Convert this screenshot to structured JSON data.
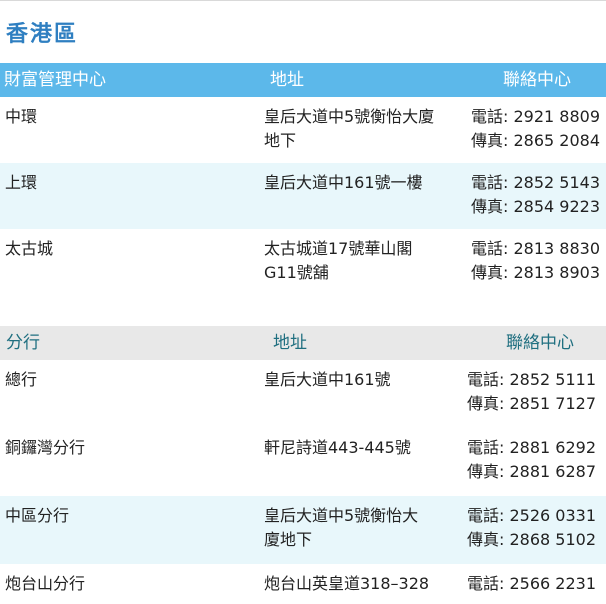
{
  "region": "香港區",
  "wealth": {
    "headers": [
      "財富管理中心",
      "地址",
      "聯絡中心"
    ],
    "rows": [
      {
        "name": "中環",
        "address": "皇后大道中5號衡怡大廈\n地下",
        "phone": "電話: 2921 8809",
        "fax": "傳真: 2865 2084"
      },
      {
        "name": "上環",
        "address": "皇后大道中161號一樓",
        "phone": "電話: 2852 5143",
        "fax": "傳真: 2854 9223"
      },
      {
        "name": "太古城",
        "address": "太古城道17號華山閣\nG11號舖",
        "phone": "電話: 2813 8830",
        "fax": "傳真: 2813 8903"
      }
    ]
  },
  "branch": {
    "headers": [
      "分行",
      "地址",
      "聯絡中心"
    ],
    "rows": [
      {
        "name": "總行",
        "address": "皇后大道中161號",
        "phone": "電話: 2852 5111",
        "fax": "傳真: 2851 7127"
      },
      {
        "name": "銅鑼灣分行",
        "address": "軒尼詩道443-445號",
        "phone": "電話: 2881 6292",
        "fax": "傳真: 2881 6287"
      },
      {
        "name": "中區分行",
        "address": "皇后大道中5號衡怡大\n廈地下",
        "phone": "電話: 2526 0331",
        "fax": "傳真: 2868 5102"
      },
      {
        "name": "炮台山分行",
        "address": "炮台山英皇道318–328",
        "phone": "電話: 2566 2231",
        "fax": ""
      }
    ]
  },
  "colors": {
    "title": "#2f7fc1",
    "wealth_header": "#5cb8ea",
    "branch_header": "#e8e8e8",
    "alt_row": "#e8f7fb"
  }
}
